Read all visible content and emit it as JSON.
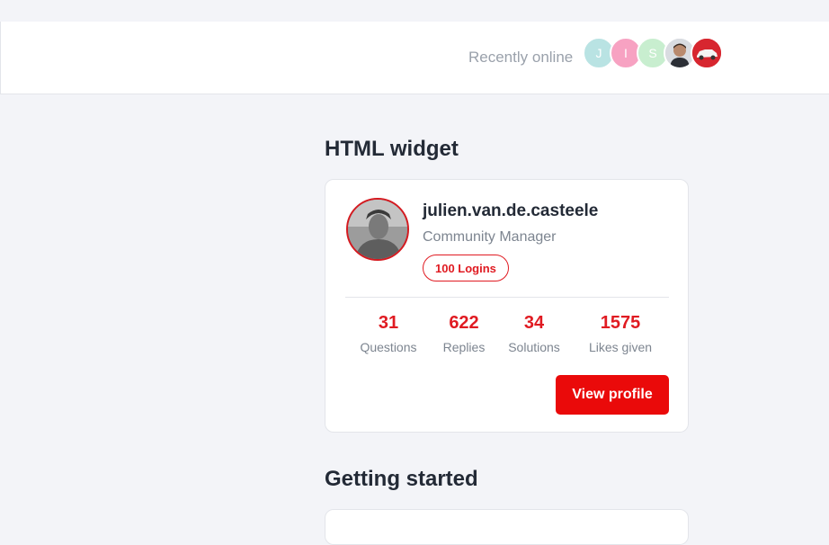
{
  "header": {
    "recent_label": "Recently online",
    "avatars": [
      {
        "initial": "J",
        "color": "#b9e3e3"
      },
      {
        "initial": "I",
        "color": "#f7a2c2"
      },
      {
        "initial": "S",
        "color": "#c8eecf"
      },
      {
        "initial": "",
        "icon": "person-photo"
      },
      {
        "initial": "",
        "icon": "car-photo"
      }
    ]
  },
  "widget": {
    "title": "HTML widget",
    "username": "julien.van.de.casteele",
    "role": "Community Manager",
    "badge": "100 Logins",
    "stats": [
      {
        "value": "31",
        "label": "Questions"
      },
      {
        "value": "622",
        "label": "Replies"
      },
      {
        "value": "34",
        "label": "Solutions"
      },
      {
        "value": "1575",
        "label": "Likes given"
      }
    ],
    "button": "View profile"
  },
  "getting_started": {
    "title": "Getting started"
  },
  "colors": {
    "accent": "#e01b22",
    "button": "#ea0a0a",
    "text": "#232a36",
    "muted": "#7d8590"
  }
}
